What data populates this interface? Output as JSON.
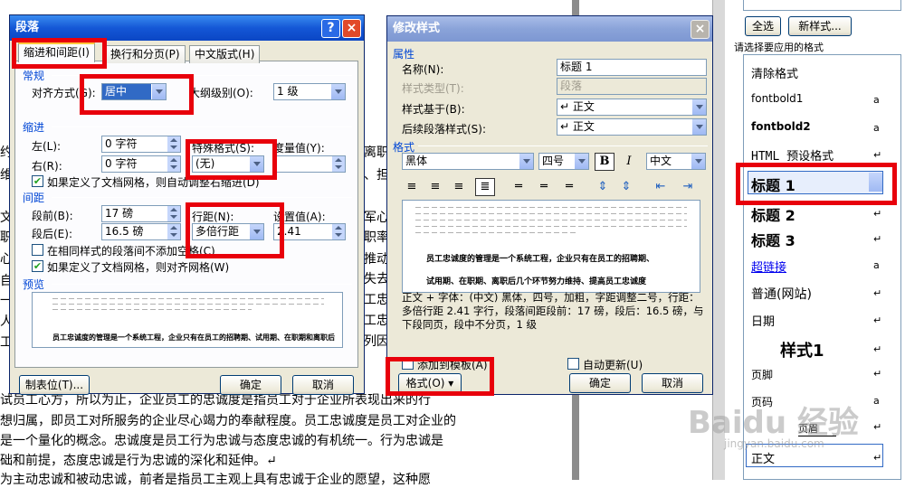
{
  "document": {
    "left_chars": [
      "约",
      "维",
      "文",
      "职",
      "心",
      "自",
      "一",
      "人",
      "工"
    ],
    "right_lines": [
      "离职",
      "、担",
      "",
      "军心",
      "职率",
      "推动",
      "失去",
      "工忠",
      "工忠",
      "列因"
    ],
    "bottom_lines": [
      "试员工心方，所以为止，企业员工的忠诚度是指员工对于企业所表现出来的行",
      "想归属，即员工对所服务的企业尽心竭力的奉献程度。员工忠诚度是员工对企业的",
      "是一个量化的概念。忠诚度是员工行为忠诚与态度忠诚的有机统一。行为忠诚是",
      "础和前提，态度忠诚是行为忠诚的深化和延伸。↵",
      "为主动忠诚和被动忠诚，前者是指员工主观上具有忠诚于企业的愿望，这种愿"
    ]
  },
  "paragraph_dialog": {
    "title": "段落",
    "help": "?",
    "close": "×",
    "tabs": [
      "缩进和间距(I)",
      "换行和分页(P)",
      "中文版式(H)"
    ],
    "sections": {
      "general": "常规",
      "indent": "缩进",
      "spacing": "间距",
      "preview": "预览"
    },
    "alignment": {
      "label": "对齐方式(G):",
      "value": "居中"
    },
    "outline": {
      "label": "大纲级别(O):",
      "value": "1 级"
    },
    "left": {
      "label": "左(L):",
      "value": "0 字符"
    },
    "right": {
      "label": "右(R):",
      "value": "0 字符"
    },
    "special": {
      "label": "特殊格式(S):",
      "value": "(无)"
    },
    "measure": {
      "label": "度量值(Y):",
      "value": ""
    },
    "grid_indent": "如果定义了文档网格，则自动调整右缩进(D)",
    "before": {
      "label": "段前(B):",
      "value": "17 磅"
    },
    "after": {
      "label": "段后(E):",
      "value": "16.5 磅"
    },
    "line_spacing": {
      "label": "行距(N):",
      "value": "多倍行距"
    },
    "set_value": {
      "label": "设置值(A):",
      "value": "2.41"
    },
    "no_space": "在相同样式的段落间不添加空格(C)",
    "grid_align": "如果定义了文档网格，则对齐网格(W)",
    "preview_text": "员工忠诚度的管理是一个系统工程，企业只有在员工的招聘期、试用期、在职期和离职后",
    "tabs_button": "制表位(T)...",
    "ok": "确定",
    "cancel": "取消"
  },
  "modify_style_dialog": {
    "title": "修改样式",
    "close": "×",
    "attributes_header": "属性",
    "name": {
      "label": "名称(N):",
      "value": "标题 1"
    },
    "style_type": {
      "label": "样式类型(T):",
      "value": "段落"
    },
    "based_on": {
      "label": "样式基于(B):",
      "value": "↵ 正文"
    },
    "next_style": {
      "label": "后续段落样式(S):",
      "value": "↵ 正文"
    },
    "format_header": "格式",
    "font": "黑体",
    "size": "四号",
    "bold": "B",
    "italic": "I",
    "lang": "中文",
    "preview_line1": "员工忠诚度的管理是一个系统工程，企业只有在员工的招聘期、",
    "preview_line2": "试用期、在职期、离职后几个环节努力维持、提高员工忠诚度",
    "description": "正文 + 字体：(中文) 黑体，四号，加粗，字距调整二号，行距：多倍行距 2.41 字行，段落间距段前：17 磅，段后：16.5 磅，与下段同页，段中不分页，1 级",
    "add_template": "添加到模板(A)",
    "auto_update": "自动更新(U)",
    "format_button": "格式(O) ▾",
    "ok": "确定",
    "cancel": "取消"
  },
  "task_pane": {
    "select_all": "全选",
    "new_style": "新样式...",
    "prompt": "请选择要应用的格式",
    "items": [
      {
        "label": "清除格式",
        "mark": ""
      },
      {
        "label": "fontbold1",
        "mark": "a"
      },
      {
        "label": "fontbold2",
        "mark": "a"
      },
      {
        "label": "HTML 预设格式",
        "mark": "↵"
      },
      {
        "label": "标题 1",
        "mark": "↵"
      },
      {
        "label": "标题 2",
        "mark": "↵"
      },
      {
        "label": "标题 3",
        "mark": "↵"
      },
      {
        "label": "超链接",
        "mark": "a"
      },
      {
        "label": "普通(网站)",
        "mark": "↵"
      },
      {
        "label": "日期",
        "mark": "↵"
      },
      {
        "label": "样式1",
        "mark": "↵"
      },
      {
        "label": "页脚",
        "mark": "↵"
      },
      {
        "label": "页码",
        "mark": "a"
      },
      {
        "label": "页眉",
        "mark": "↵"
      },
      {
        "label": "正文",
        "mark": "↵"
      }
    ],
    "watermark": "Baidu 经验",
    "watermark_url": "jingyan.baidu.com"
  }
}
